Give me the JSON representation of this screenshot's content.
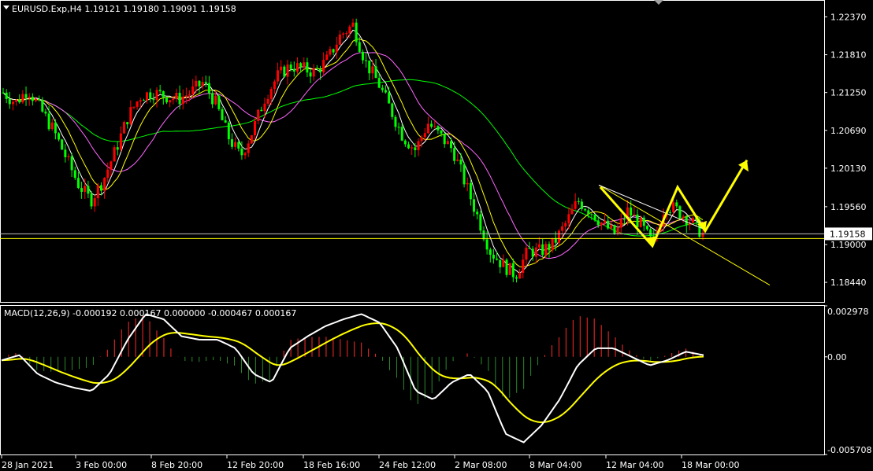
{
  "chart_data": [
    {
      "type": "candlestick",
      "header": "EURUSD.Exp,H4  1.19121 1.19180 1.19091 1.19158",
      "symbol": "EURUSD.Exp",
      "timeframe": "H4",
      "ohlc_last": {
        "open": 1.19121,
        "high": 1.1918,
        "low": 1.19091,
        "close": 1.19158
      },
      "current_price_label": "1.19158",
      "current_price": 1.19158,
      "y_ticks": [
        "1.22370",
        "1.21810",
        "1.21250",
        "1.20690",
        "1.20130",
        "1.19560",
        "1.19000",
        "1.18440"
      ],
      "ylim": [
        1.1815,
        1.2262
      ],
      "x_ticks": [
        "28 Jan 2021",
        "3 Feb 00:00",
        "8 Feb 20:00",
        "12 Feb 20:00",
        "18 Feb 16:00",
        "24 Feb 12:00",
        "2 Mar 08:00",
        "8 Mar 04:00",
        "12 Mar 04:00",
        "18 Mar 00:00"
      ],
      "price_path_approx": [
        1.2125,
        1.211,
        1.213,
        1.21,
        1.207,
        1.203,
        1.199,
        1.1965,
        1.1995,
        1.204,
        1.209,
        1.212,
        1.2125,
        1.212,
        1.2115,
        1.2125,
        1.214,
        1.211,
        1.206,
        1.203,
        1.207,
        1.212,
        1.215,
        1.2165,
        1.216,
        1.2155,
        1.2175,
        1.221,
        1.2225,
        1.217,
        1.214,
        1.21,
        1.206,
        1.204,
        1.208,
        1.206,
        1.204,
        1.199,
        1.194,
        1.189,
        1.187,
        1.1855,
        1.189,
        1.189,
        1.19,
        1.193,
        1.1965,
        1.195,
        1.193,
        1.1915,
        1.195,
        1.193,
        1.19,
        1.196,
        1.195,
        1.1935,
        1.1916
      ],
      "moving_averages": [
        {
          "color": "#00ff00",
          "role": "slow"
        },
        {
          "color": "#ff66ff",
          "role": "medium"
        },
        {
          "color": "#ffff00",
          "role": "fast"
        },
        {
          "color": "#ffffff",
          "role": "fastest"
        }
      ],
      "colors": {
        "up": "#ff0000",
        "down": "#00ff00",
        "background": "#000000",
        "current_line": "#ffff00"
      }
    },
    {
      "type": "line",
      "title": "MACD(12,26,9) -0.000192 0.000167 0.000000 -0.000467 0.000167",
      "y_ticks": [
        "0.002978",
        "0.00",
        "-0.005708"
      ],
      "ylim": [
        -0.005708,
        0.002978
      ],
      "series": [
        {
          "name": "MACD",
          "color": "#ffffff"
        },
        {
          "name": "Signal",
          "color": "#ffff00"
        }
      ],
      "macd_path_approx": [
        -0.0002,
        0.0001,
        -0.001,
        -0.0015,
        -0.0018,
        -0.002,
        -0.001,
        0.001,
        0.0025,
        0.0022,
        0.0012,
        0.001,
        0.001,
        0.0005,
        -0.001,
        -0.0015,
        0.0005,
        0.0012,
        0.0018,
        0.0022,
        0.0025,
        0.002,
        0.0005,
        -0.002,
        -0.0025,
        -0.0015,
        -0.001,
        -0.002,
        -0.0045,
        -0.005,
        -0.004,
        -0.0025,
        -0.0005,
        0.0005,
        0.0005,
        0.0,
        -0.0005,
        -0.0002,
        0.0003,
        0.0001
      ],
      "histogram_colors": {
        "up": "#ff2a2a",
        "down": "#2a8a2a"
      }
    }
  ],
  "annotations": {
    "trend_arrow_color": "#ffff00"
  }
}
